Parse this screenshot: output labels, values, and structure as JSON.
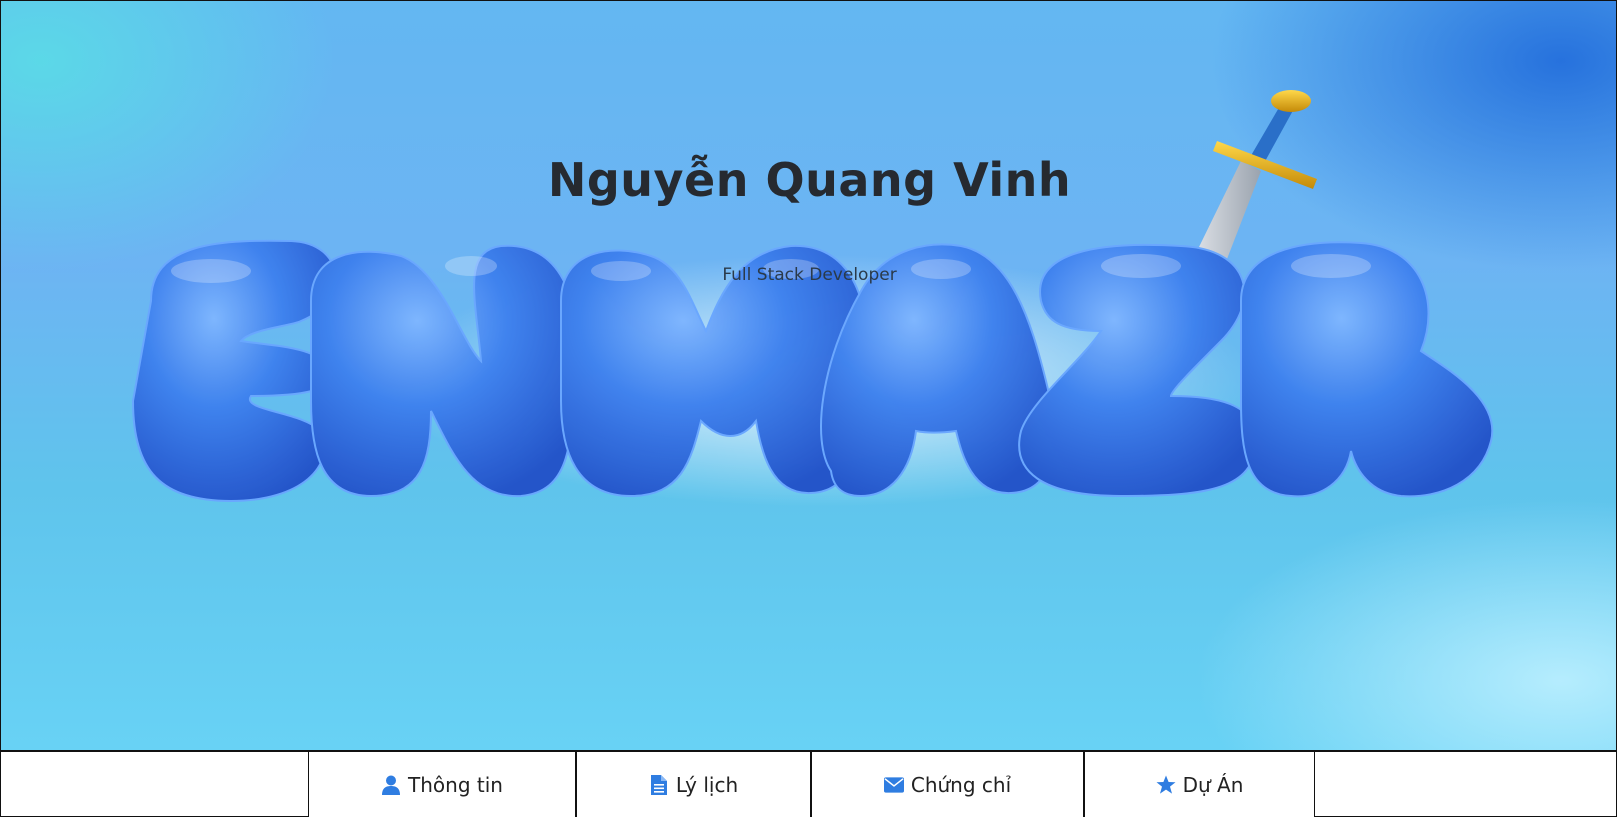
{
  "hero": {
    "title": "Nguyễn Quang Vinh",
    "subtitle": "Full Stack Developer",
    "logo_text": "ENMAZR"
  },
  "nav": {
    "items": [
      {
        "label": "Thông tin",
        "icon": "user-icon"
      },
      {
        "label": "Lý lịch",
        "icon": "document-icon"
      },
      {
        "label": "Chứng chỉ",
        "icon": "envelope-icon"
      },
      {
        "label": "Dự Án",
        "icon": "star-icon"
      }
    ]
  },
  "colors": {
    "accent": "#2f7de1",
    "logo_blue": "#3a7ee8",
    "text_dark": "#262a30"
  }
}
